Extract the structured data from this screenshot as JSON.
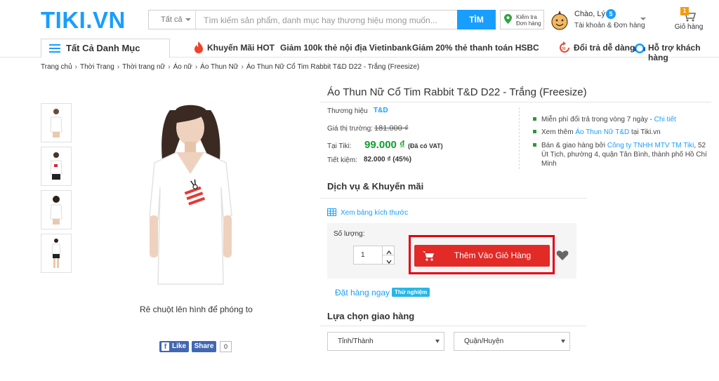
{
  "header": {
    "logo": "TIKI.VN",
    "search": {
      "category": "Tất cả",
      "placeholder": "Tìm kiếm sản phẩm, danh mục hay thương hiệu mong muốn...",
      "button": "TÌM"
    },
    "check_order": {
      "line1": "Kiểm tra",
      "line2": "Đơn hàng"
    },
    "account": {
      "greeting": "Chào, Lý",
      "badge": "5",
      "subtitle": "Tài khoản & Đơn hàng"
    },
    "cart": {
      "count": "1",
      "label": "Giỏ hàng"
    }
  },
  "nav": {
    "categories": "Tất Cả Danh Mục",
    "promos": [
      "Khuyến Mãi HOT",
      "Giảm 100k thẻ nội địa Vietinbank",
      "Giảm 20% thẻ thanh toán HSBC"
    ],
    "returns": "Đổi trả dễ dàng",
    "support": "Hỗ trợ khách hàng"
  },
  "breadcrumb": [
    "Trang chủ",
    "Thời Trang",
    "Thời trang nữ",
    "Áo nữ",
    "Áo Thun Nữ",
    "Áo Thun Nữ Cổ Tim Rabbit T&D D22 - Trắng (Freesize)"
  ],
  "gallery": {
    "zoom_hint": "Rê chuột lên hình để phóng to"
  },
  "social": {
    "like": "Like",
    "share": "Share",
    "count": "0"
  },
  "product": {
    "title": "Áo Thun Nữ Cổ Tim Rabbit T&D D22 - Trắng (Freesize)",
    "brand_label": "Thương hiệu",
    "brand": "T&D",
    "market_label": "Giá thị trường:",
    "market_price": "181.000 ₫",
    "tiki_label": "Tại Tiki:",
    "price": "99.000 ₫",
    "vat": "(Đã có VAT)",
    "saving_label": "Tiết kiệm:",
    "saving": "82.000 ₫ (45%)"
  },
  "perks": {
    "p1_text": "Miễn phí đổi trả trong vòng 7 ngày - ",
    "p1_link": "Chi tiết",
    "p2_text": "Xem thêm ",
    "p2_link": "Áo Thun Nữ T&D",
    "p2_tail": " tại Tiki.vn",
    "p3_text": "Bán & giao hàng bởi ",
    "p3_link": "Công ty TNHH MTV TM Tiki",
    "p3_tail": ", 52 Út Tịch, phường 4, quận Tân Bình, thành phố Hồ Chí Minh"
  },
  "services": {
    "title": "Dịch vụ & Khuyến mãi",
    "size_guide": "Xem bảng kích thước"
  },
  "purchase": {
    "qty_label": "Số lượng:",
    "qty": "1",
    "add_to_cart": "Thêm Vào Giỏ Hàng",
    "order_now": "Đặt hàng ngay",
    "trial_badge": "Thử nghiệm"
  },
  "delivery": {
    "title": "Lựa chọn giao hàng",
    "province": "Tỉnh/Thành",
    "district": "Quận/Huyện"
  },
  "colors": {
    "brand_blue": "#189eff",
    "price_green": "#0f9f2c",
    "cart_red": "#e22a27",
    "highlight_red": "#e3000f"
  }
}
